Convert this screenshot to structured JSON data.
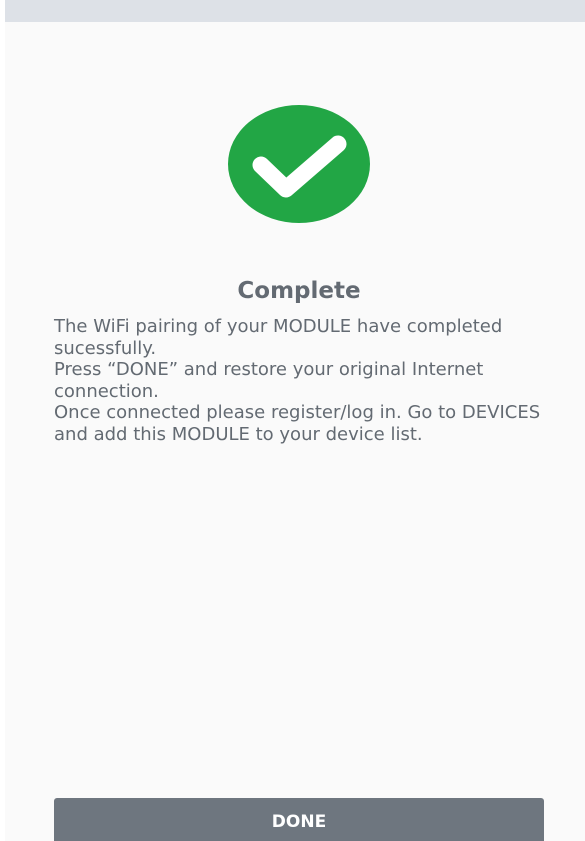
{
  "status_icon": {
    "icon": "checkmark-icon",
    "color": "#22a645"
  },
  "complete": {
    "title": "Complete",
    "lines": [
      "The WiFi pairing of your MODULE have completed sucessfully.",
      "Press “DONE” and restore your original Internet connection.",
      "Once connected please register/log in. Go to DEVICES and add this MODULE to your device list."
    ]
  },
  "actions": {
    "done_label": "DONE"
  }
}
